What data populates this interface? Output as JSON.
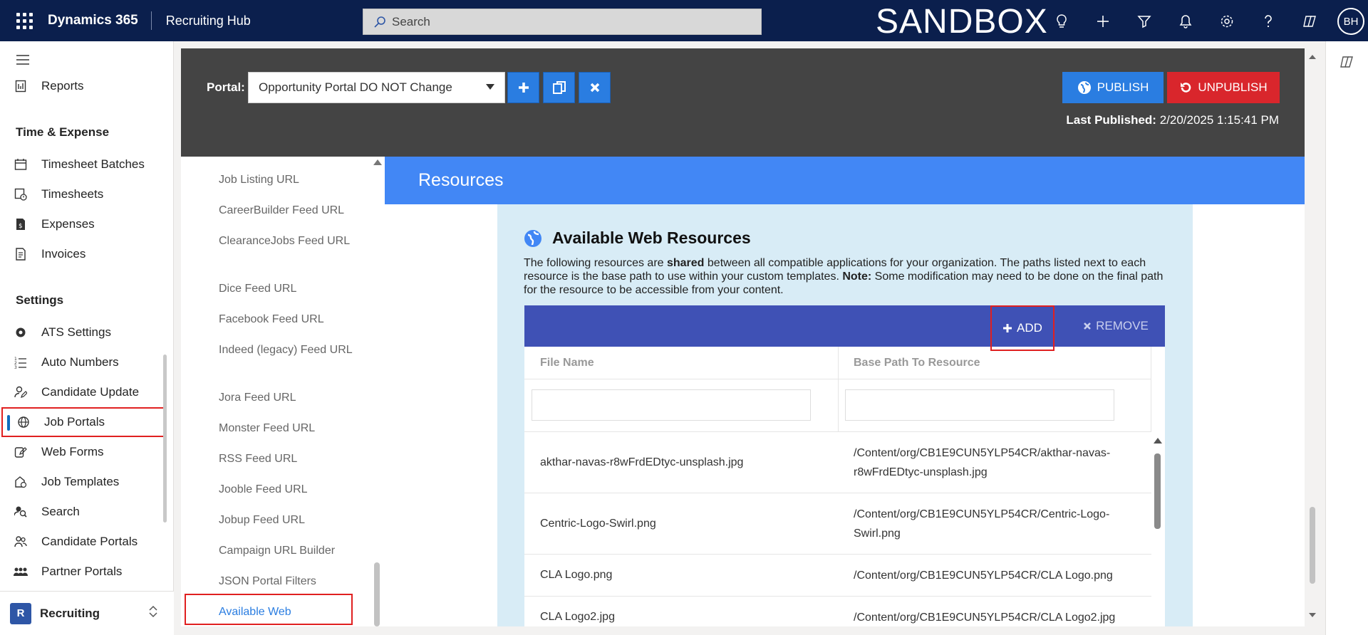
{
  "topbar": {
    "app_name": "Dynamics 365",
    "app_sub": "Recruiting Hub",
    "search_placeholder": "Search",
    "environment": "SANDBOX",
    "avatar": "BH"
  },
  "leftnav": {
    "items_top": [
      {
        "label": "Reports",
        "icon": "report-icon"
      }
    ],
    "section_time": "Time & Expense",
    "time_items": [
      {
        "label": "Timesheet Batches",
        "icon": "timesheet-batches-icon"
      },
      {
        "label": "Timesheets",
        "icon": "timesheets-icon"
      },
      {
        "label": "Expenses",
        "icon": "expenses-icon"
      },
      {
        "label": "Invoices",
        "icon": "invoices-icon"
      }
    ],
    "section_settings": "Settings",
    "settings_items": [
      {
        "label": "ATS Settings",
        "icon": "gear-icon"
      },
      {
        "label": "Auto Numbers",
        "icon": "numbered-list-icon"
      },
      {
        "label": "Candidate Update",
        "icon": "person-edit-icon"
      },
      {
        "label": "Job Portals",
        "icon": "globe-icon"
      },
      {
        "label": "Web Forms",
        "icon": "form-edit-icon"
      },
      {
        "label": "Job Templates",
        "icon": "template-icon"
      },
      {
        "label": "Search",
        "icon": "search-people-icon"
      },
      {
        "label": "Candidate Portals",
        "icon": "people-icon"
      },
      {
        "label": "Partner Portals",
        "icon": "group-icon"
      }
    ],
    "area_badge": "R",
    "area_name": "Recruiting"
  },
  "portal": {
    "label": "Portal:",
    "selected": "Opportunity Portal DO NOT Change",
    "publish_label": "PUBLISH",
    "unpublish_label": "UNPUBLISH",
    "last_published_label": "Last Published:",
    "last_published_value": "2/20/2025 1:15:41 PM"
  },
  "settings_list": [
    "Job Listing URL",
    "CareerBuilder Feed URL",
    "ClearanceJobs Feed URL",
    "Dice Feed URL",
    "Facebook Feed URL",
    "Indeed (legacy) Feed URL",
    "Jora Feed URL",
    "Monster Feed URL",
    "RSS Feed URL",
    "Jooble Feed URL",
    "Jobup Feed URL",
    "Campaign URL Builder",
    "JSON Portal Filters",
    "Available Web"
  ],
  "resources": {
    "banner": "Resources",
    "title": "Available Web Resources",
    "desc_1": "The following resources are ",
    "desc_bold_1": "shared",
    "desc_2": " between all compatible applications for your organization. The paths listed next to each resource is the base path to use within your custom templates. ",
    "desc_bold_2": "Note:",
    "desc_3": " Some modification may need to be done on the final path for the resource to be accessible from your content.",
    "add_label": "ADD",
    "remove_label": "REMOVE",
    "columns": [
      "File Name",
      "Base Path To Resource"
    ],
    "rows": [
      {
        "name": "akthar-navas-r8wFrdEDtyc-unsplash.jpg",
        "path": "/Content/org/CB1E9CUN5YLP54CR/akthar-navas-r8wFrdEDtyc-unsplash.jpg"
      },
      {
        "name": "Centric-Logo-Swirl.png",
        "path": "/Content/org/CB1E9CUN5YLP54CR/Centric-Logo-Swirl.png"
      },
      {
        "name": "CLA Logo.png",
        "path": "/Content/org/CB1E9CUN5YLP54CR/CLA Logo.png"
      },
      {
        "name": "CLA Logo2.jpg",
        "path": "/Content/org/CB1E9CUN5YLP54CR/CLA Logo2.jpg"
      }
    ]
  },
  "colors": {
    "topbar": "#0b1f4d",
    "accent": "#2a7de1",
    "banner": "#4287f5",
    "toolbar": "#3f51b5",
    "danger": "#d9262c"
  }
}
